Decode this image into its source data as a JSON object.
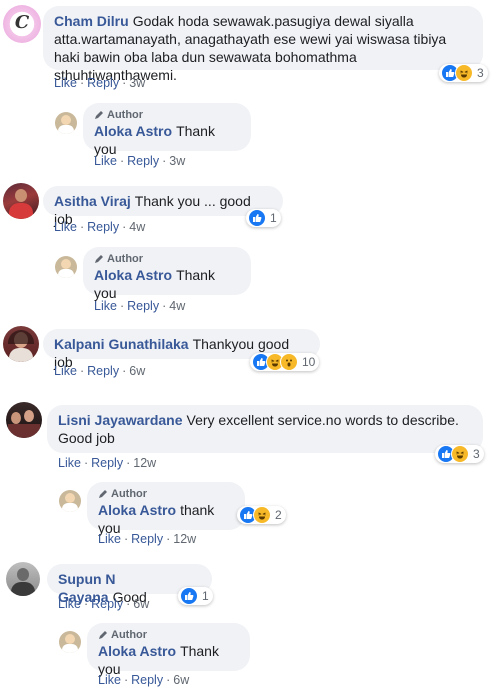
{
  "comments": [
    {
      "author": "Cham Dilru",
      "text": "Godak hoda sewawak.pasugiya dewal siyalla atta.wartamanayath, anagathayath ese wewi yai wiswasa tibiya haki bawin oba laba dun sewawata bohomathma sthuhtiwanthawemi.",
      "like": "Like",
      "reply": "Reply",
      "time": "3w",
      "reaction_count": "3",
      "avatar_letter": "C"
    },
    {
      "author": "Asitha Viraj",
      "text": "Thank you ... good job",
      "like": "Like",
      "reply": "Reply",
      "time": "4w",
      "reaction_count": "1"
    },
    {
      "author": "Kalpani Gunathilaka",
      "text": "Thankyou good job",
      "like": "Like",
      "reply": "Reply",
      "time": "6w",
      "reaction_count": "10"
    },
    {
      "author": "Lisni Jayawardane",
      "text": "Very excellent service.no words to describe. Good job",
      "like": "Like",
      "reply": "Reply",
      "time": "12w",
      "reaction_count": "3"
    },
    {
      "author": "Supun N Gayana",
      "text": "Good",
      "like": "Like",
      "reply": "Reply",
      "time": "6w",
      "reaction_count": "1"
    }
  ],
  "replies": [
    {
      "badge": "Author",
      "author": "Aloka Astro",
      "text": "Thank you",
      "like": "Like",
      "reply": "Reply",
      "time": "3w"
    },
    {
      "badge": "Author",
      "author": "Aloka Astro",
      "text": "Thank you",
      "like": "Like",
      "reply": "Reply",
      "time": "4w"
    },
    {
      "badge": "Author",
      "author": "Aloka Astro",
      "text": "thank you",
      "like": "Like",
      "reply": "Reply",
      "time": "12w",
      "reaction_count": "2"
    },
    {
      "badge": "Author",
      "author": "Aloka Astro",
      "text": "Thank you",
      "like": "Like",
      "reply": "Reply",
      "time": "6w"
    }
  ],
  "separator": "·",
  "colors": {
    "link": "#385898",
    "bubble": "#f0f2f5",
    "like": "#1877f2",
    "haha": "#f7b928"
  }
}
